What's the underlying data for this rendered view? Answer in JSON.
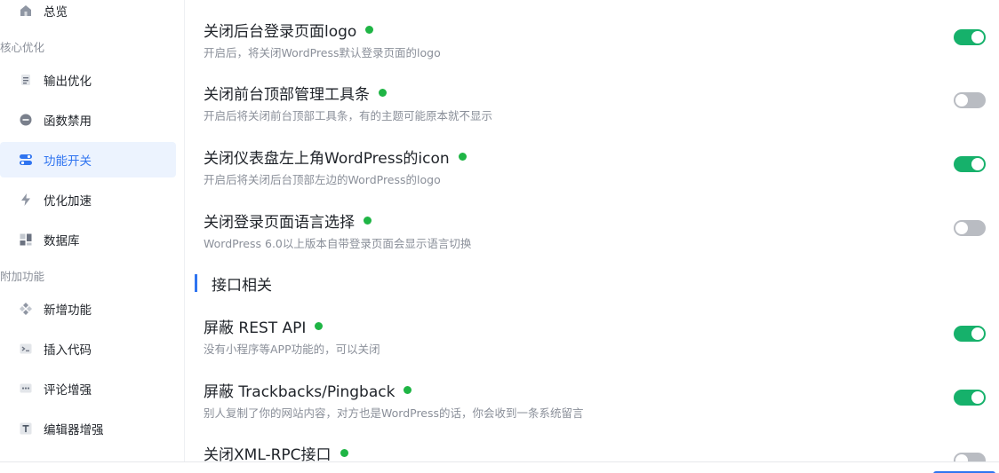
{
  "sidebar": {
    "top_item": {
      "label": "总览",
      "icon": "home-icon"
    },
    "section_core": "核心优化",
    "core_items": [
      {
        "label": "输出优化",
        "icon": "document-icon"
      },
      {
        "label": "函数禁用",
        "icon": "minus-circle-icon"
      },
      {
        "label": "功能开关",
        "icon": "toggle-icon",
        "active": true
      },
      {
        "label": "优化加速",
        "icon": "lightning-icon"
      },
      {
        "label": "数据库",
        "icon": "database-icon"
      }
    ],
    "section_extra": "附加功能",
    "extra_items": [
      {
        "label": "新增功能",
        "icon": "diamond-icon"
      },
      {
        "label": "插入代码",
        "icon": "terminal-icon"
      },
      {
        "label": "评论增强",
        "icon": "comment-icon"
      },
      {
        "label": "编辑器增强",
        "icon": "text-icon"
      }
    ]
  },
  "settings": [
    {
      "title": "关闭后台登录页面logo",
      "desc": "开启后，将关闭WordPress默认登录页面的logo",
      "enabled": true
    },
    {
      "title": "关闭前台顶部管理工具条",
      "desc": "开启后将关闭前台顶部工具条，有的主题可能原本就不显示",
      "enabled": false
    },
    {
      "title": "关闭仪表盘左上角WordPress的icon",
      "desc": "开启后将关闭后台顶部左边的WordPress的logo",
      "enabled": true
    },
    {
      "title": "关闭登录页面语言选择",
      "desc": "WordPress 6.0以上版本自带登录页面会显示语言切换",
      "enabled": false
    }
  ],
  "api_section": {
    "heading": "接口相关",
    "settings": [
      {
        "title": "屏蔽 REST API",
        "desc": "没有小程序等APP功能的，可以关闭",
        "enabled": true
      },
      {
        "title": "屏蔽 Trackbacks/Pingback",
        "desc": "别人复制了你的网站内容，对方也是WordPress的话，你会收到一条系统留言",
        "enabled": true
      },
      {
        "title": "关闭XML-RPC接口",
        "desc": "",
        "enabled": false
      }
    ]
  },
  "colors": {
    "accent": "#2f74f0",
    "toggle_on": "#16b16b",
    "status_dot": "#1fb545"
  }
}
